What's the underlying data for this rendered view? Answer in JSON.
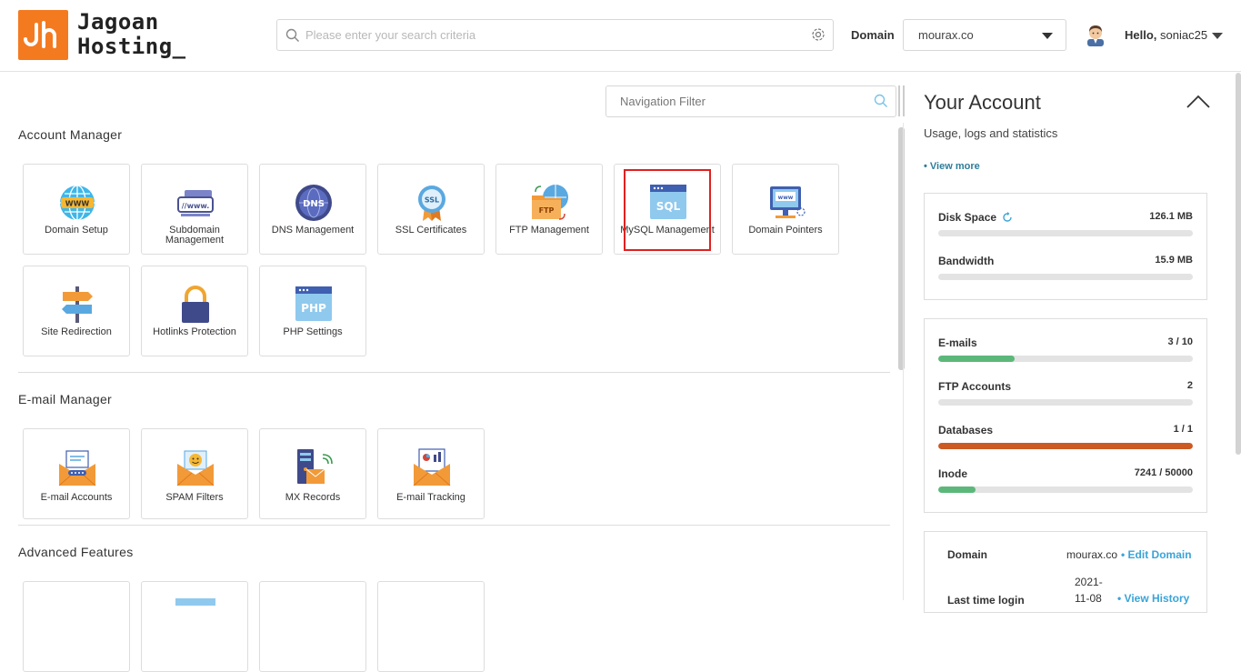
{
  "brand": {
    "name_line1": "Jagoan",
    "name_line2": "Hosting_",
    "logo_color": "#f47a20"
  },
  "header": {
    "search_placeholder": "Please enter your search criteria",
    "domain_label": "Domain",
    "domain_value": "mourax.co",
    "hello_prefix": "Hello,",
    "username": "soniac25"
  },
  "nav_filter": {
    "placeholder": "Navigation Filter"
  },
  "sections": {
    "account_manager": {
      "title": "Account Manager",
      "items": [
        {
          "label": "Domain Setup",
          "icon": "globe-www-icon"
        },
        {
          "label": "Subdomain Management",
          "icon": "subdomain-www-icon"
        },
        {
          "label": "DNS Management",
          "icon": "dns-globe-icon"
        },
        {
          "label": "SSL Certificates",
          "icon": "ssl-badge-icon"
        },
        {
          "label": "FTP Management",
          "icon": "ftp-folder-icon"
        },
        {
          "label": "MySQL Management",
          "icon": "sql-window-icon"
        },
        {
          "label": "Domain Pointers",
          "icon": "monitor-www-icon"
        },
        {
          "label": "Site Redirection",
          "icon": "signpost-icon"
        },
        {
          "label": "Hotlinks Protection",
          "icon": "padlock-icon"
        },
        {
          "label": "PHP Settings",
          "icon": "php-window-icon"
        }
      ]
    },
    "email_manager": {
      "title": "E-mail Manager",
      "items": [
        {
          "label": "E-mail Accounts",
          "icon": "envelope-icon"
        },
        {
          "label": "SPAM Filters",
          "icon": "envelope-smiley-icon"
        },
        {
          "label": "MX Records",
          "icon": "server-envelope-icon"
        },
        {
          "label": "E-mail Tracking",
          "icon": "envelope-chart-icon"
        }
      ]
    },
    "advanced": {
      "title": "Advanced Features"
    }
  },
  "account": {
    "title": "Your Account",
    "subtitle": "Usage, logs and statistics",
    "view_more": "• View more",
    "usage": [
      {
        "name": "Disk Space",
        "value": "126.1 MB",
        "fraction": 0
      },
      {
        "name": "Bandwidth",
        "value": "15.9 MB",
        "fraction": 0
      }
    ],
    "limits": [
      {
        "name": "E-mails",
        "value": "3 / 10",
        "fraction": 0.3,
        "color": "#5cb87a"
      },
      {
        "name": "FTP Accounts",
        "value": "2",
        "fraction": 0,
        "color": "#5cb87a"
      },
      {
        "name": "Databases",
        "value": "1 / 1",
        "fraction": 1.0,
        "color": "#cc5a22"
      },
      {
        "name": "Inode",
        "value": "7241 / 50000",
        "fraction": 0.145,
        "color": "#5cb87a"
      }
    ],
    "info": {
      "domain_label": "Domain",
      "domain_value": "mourax.co",
      "edit_domain": "• Edit Domain",
      "last_login_label": "Last time login",
      "last_login_value_line1": "2021-",
      "last_login_value_line2": "11-08",
      "view_history": "• View History"
    }
  }
}
